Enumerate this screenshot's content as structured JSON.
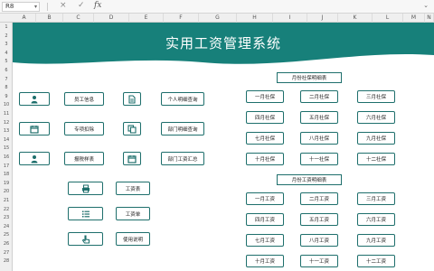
{
  "namebox": "R8",
  "formula": {
    "cancel": "×",
    "confirm": "✓",
    "fx": "fx"
  },
  "columns": [
    "A",
    "B",
    "C",
    "D",
    "E",
    "F",
    "G",
    "H",
    "I",
    "J",
    "K",
    "L",
    "M",
    "N"
  ],
  "rows": [
    "1",
    "2",
    "3",
    "4",
    "5",
    "6",
    "7",
    "8",
    "9",
    "10",
    "11",
    "12",
    "13",
    "14",
    "15",
    "16",
    "17",
    "18",
    "19",
    "20",
    "21",
    "22",
    "23",
    "24",
    "25",
    "26",
    "27",
    "28"
  ],
  "title": "实用工资管理系统",
  "colors": {
    "accent": "#1e6f6c",
    "banner": "#17807a"
  },
  "left_buttons": [
    {
      "icon": "person-icon",
      "label": "员工信息"
    },
    {
      "icon": "calendar-icon",
      "label": "专项扣除"
    },
    {
      "icon": "person-icon",
      "label": "报税样表"
    }
  ],
  "mid_buttons": [
    {
      "icon": "document-icon",
      "label": "个人明细查询"
    },
    {
      "icon": "copy-icon",
      "label": "部门明细查询"
    },
    {
      "icon": "calendar-icon",
      "label": "部门工资汇总"
    }
  ],
  "lower_buttons": [
    {
      "icon": "printer-icon",
      "label": "工资表"
    },
    {
      "icon": "list-icon",
      "label": "工资单"
    },
    {
      "icon": "hand-pointer-icon",
      "label": "使用说明"
    }
  ],
  "social": {
    "header": "月份社保明细表",
    "items": [
      "一月社保",
      "二月社保",
      "三月社保",
      "四月社保",
      "五月社保",
      "六月社保",
      "七月社保",
      "八月社保",
      "九月社保",
      "十月社保",
      "十一社保",
      "十二社保"
    ]
  },
  "wages": {
    "header": "月份工资明细表",
    "items": [
      "一月工资",
      "二月工资",
      "三月工资",
      "四月工资",
      "五月工资",
      "六月工资",
      "七月工资",
      "八月工资",
      "九月工资",
      "十月工资",
      "十一工资",
      "十二工资"
    ]
  }
}
